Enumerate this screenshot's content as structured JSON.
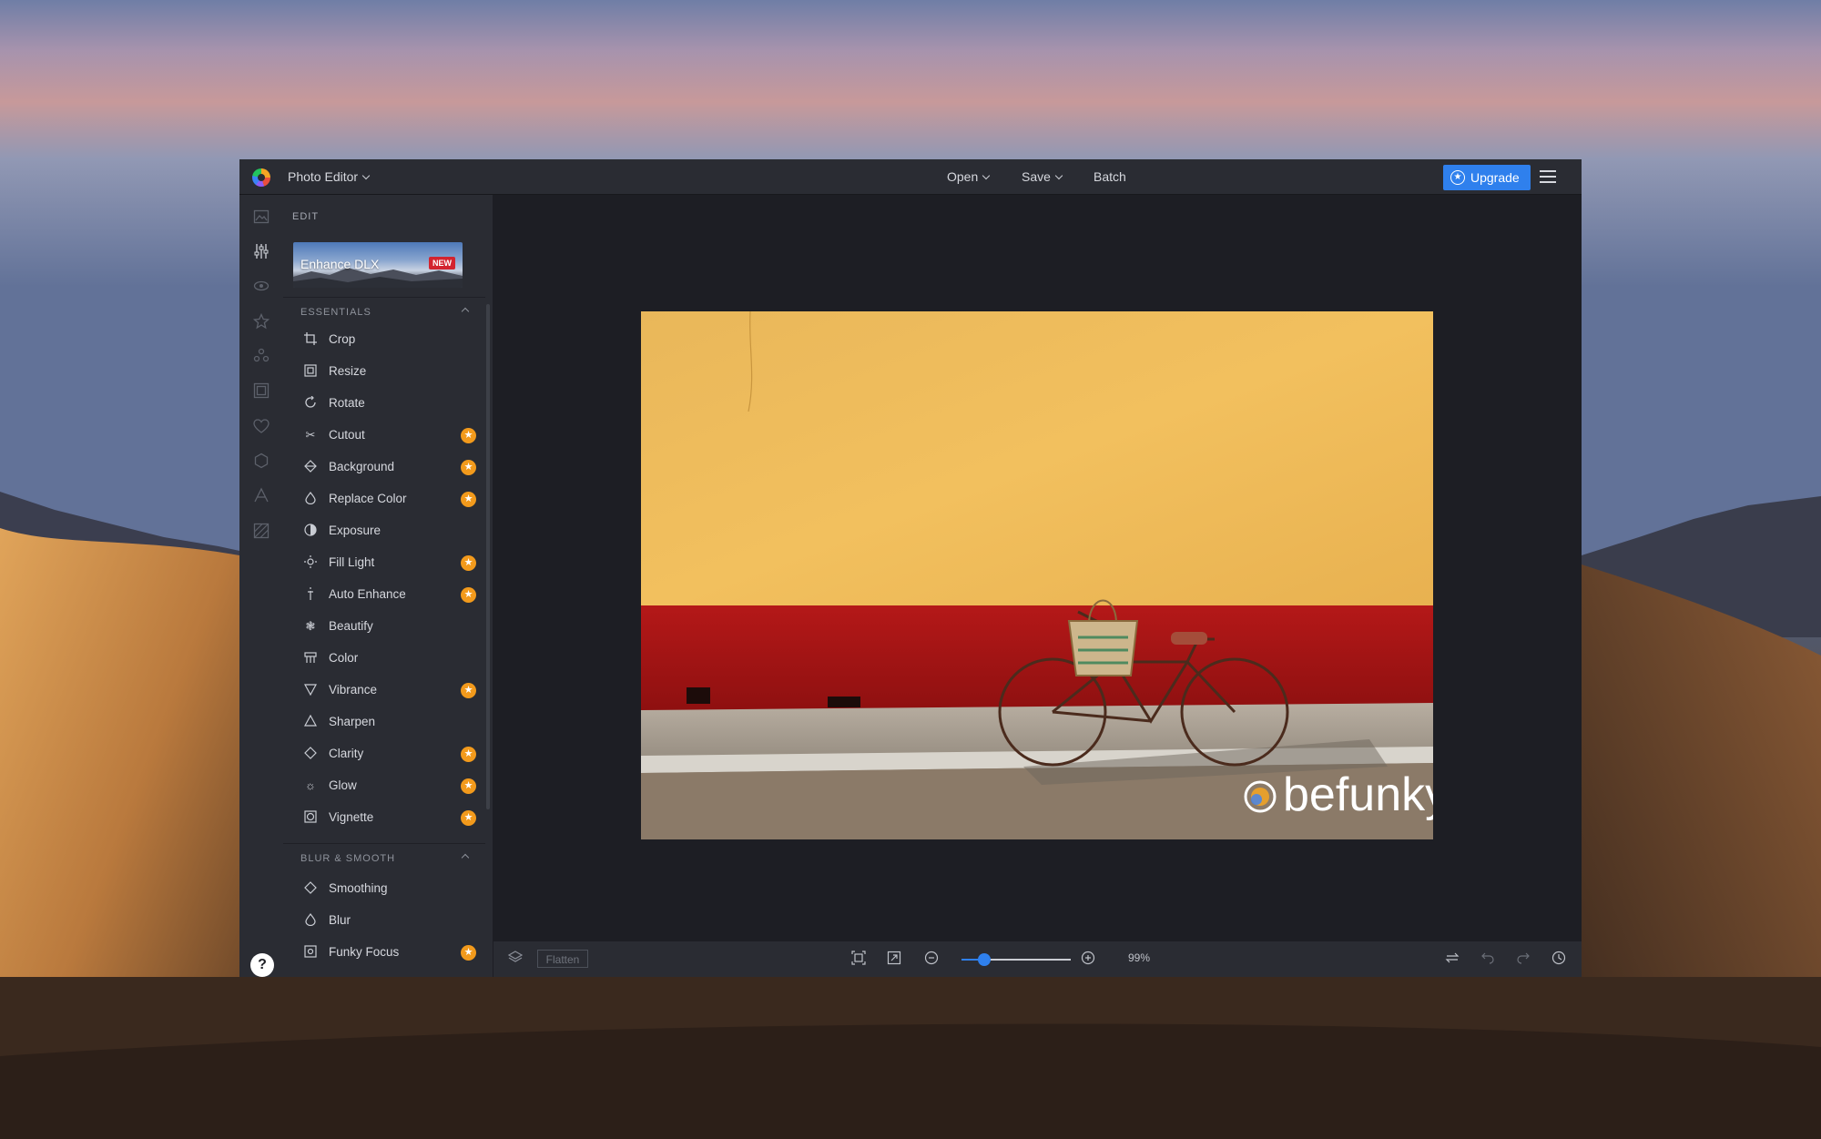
{
  "app": {
    "title": "Photo Editor",
    "logo": "befunky-logo"
  },
  "toolbar": {
    "open_label": "Open",
    "save_label": "Save",
    "batch_label": "Batch",
    "upgrade_label": "Upgrade"
  },
  "rail": {
    "icons": [
      "image-icon",
      "sliders-icon",
      "eye-icon",
      "star-icon",
      "graphics-icon",
      "frame-icon",
      "heart-icon",
      "texture-icon",
      "text-icon",
      "overlay-icon"
    ],
    "help_label": "?"
  },
  "panel": {
    "title": "EDIT",
    "enhance": {
      "label": "Enhance DLX",
      "badge": "NEW"
    },
    "sections": [
      {
        "title": "ESSENTIALS",
        "items": [
          {
            "label": "Crop",
            "icon": "crop-icon",
            "premium": false
          },
          {
            "label": "Resize",
            "icon": "resize-icon",
            "premium": false
          },
          {
            "label": "Rotate",
            "icon": "rotate-icon",
            "premium": false
          },
          {
            "label": "Cutout",
            "icon": "scissors-icon",
            "premium": true
          },
          {
            "label": "Background",
            "icon": "background-icon",
            "premium": true
          },
          {
            "label": "Replace Color",
            "icon": "droplet-icon",
            "premium": true
          },
          {
            "label": "Exposure",
            "icon": "exposure-icon",
            "premium": false
          },
          {
            "label": "Fill Light",
            "icon": "fill-light-icon",
            "premium": true
          },
          {
            "label": "Auto Enhance",
            "icon": "wand-icon",
            "premium": true
          },
          {
            "label": "Beautify",
            "icon": "beautify-icon",
            "premium": false
          },
          {
            "label": "Color",
            "icon": "color-icon",
            "premium": false
          },
          {
            "label": "Vibrance",
            "icon": "vibrance-icon",
            "premium": true
          },
          {
            "label": "Sharpen",
            "icon": "sharpen-icon",
            "premium": false
          },
          {
            "label": "Clarity",
            "icon": "clarity-icon",
            "premium": true
          },
          {
            "label": "Glow",
            "icon": "glow-icon",
            "premium": true
          },
          {
            "label": "Vignette",
            "icon": "vignette-icon",
            "premium": true
          }
        ]
      },
      {
        "title": "BLUR & SMOOTH",
        "items": [
          {
            "label": "Smoothing",
            "icon": "smoothing-icon",
            "premium": false
          },
          {
            "label": "Blur",
            "icon": "blur-icon",
            "premium": false
          },
          {
            "label": "Funky Focus",
            "icon": "focus-icon",
            "premium": true
          }
        ]
      }
    ]
  },
  "canvas": {
    "watermark": "befunky"
  },
  "bottombar": {
    "flatten_label": "Flatten",
    "zoom_value": "99%",
    "zoom_level": 0.18
  },
  "colors": {
    "accent": "#2f80ed",
    "premium": "#f29a1c",
    "badge": "#d3242f"
  }
}
